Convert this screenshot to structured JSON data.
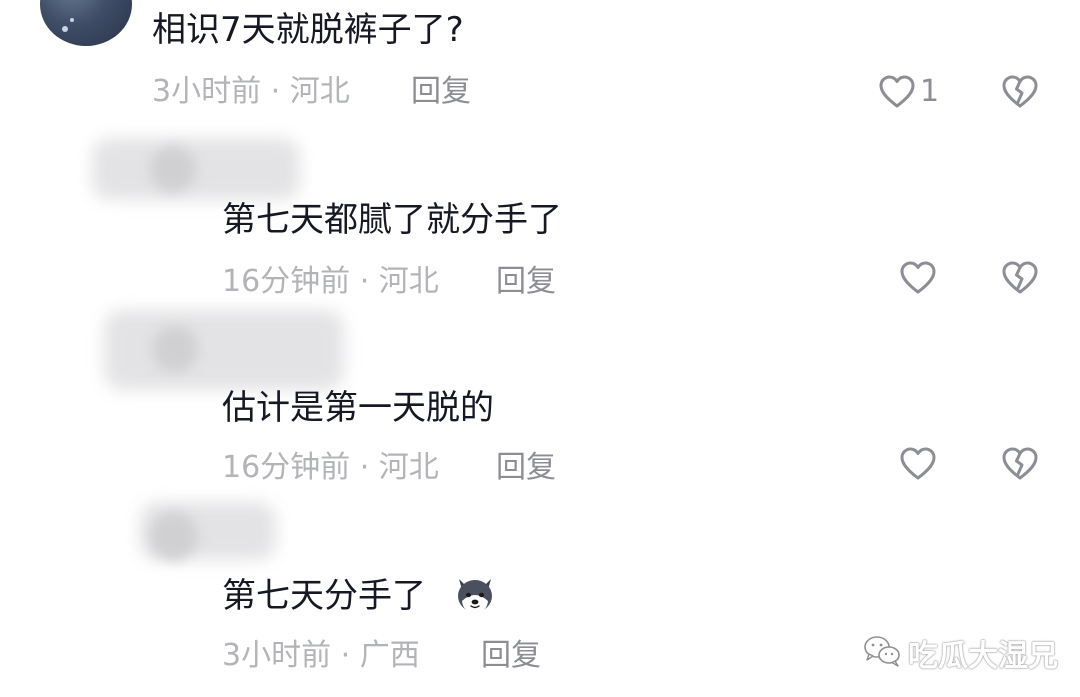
{
  "comments": [
    {
      "text": "相识7天就脱裤子了?",
      "meta": "3小时前 · 河北",
      "reply_label": "回复",
      "like_count": "1",
      "like_icon": "heart-outline-icon",
      "dislike_icon": "broken-heart-icon"
    },
    {
      "text": "第七天都腻了就分手了",
      "meta": "16分钟前 · 河北",
      "reply_label": "回复",
      "like_icon": "heart-outline-icon",
      "dislike_icon": "broken-heart-icon"
    },
    {
      "text": "估计是第一天脱的",
      "meta": "16分钟前 · 河北",
      "reply_label": "回复",
      "like_icon": "heart-outline-icon",
      "dislike_icon": "broken-heart-icon"
    },
    {
      "text": "第七天分手了",
      "emoji": "husky-dog-emoji",
      "meta": "3小时前 · 广西",
      "reply_label": "回复"
    }
  ],
  "watermark": {
    "text": "吃瓜大湿兄",
    "icon": "wechat-icon"
  },
  "colors": {
    "text": "#161823",
    "meta": "#b3b4b8",
    "reply": "#8c8e94",
    "icon": "#8c8e94"
  }
}
